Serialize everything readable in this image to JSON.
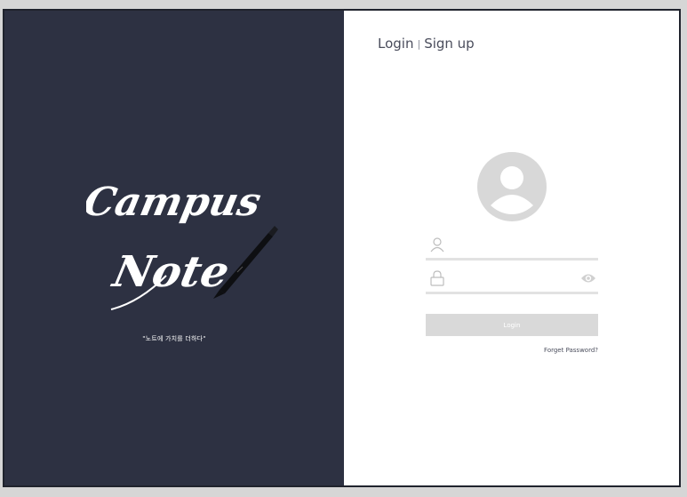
{
  "brand": {
    "logo_line1": "Campus",
    "logo_line2": "Note",
    "tagline": "\"노트에 가치를 더하다\""
  },
  "header": {
    "login_link": "Login",
    "separator": "|",
    "signup_link": "Sign up"
  },
  "form": {
    "username_placeholder": "",
    "password_placeholder": "",
    "login_button": "Login",
    "forgot_link": "Forget Password?"
  },
  "colors": {
    "panel_dark": "#2d3142",
    "page_bg": "#d6d6d6",
    "field_line": "#e2e2e2",
    "button_bg": "#d9d9d9",
    "icon_gray": "#d8d8d8"
  }
}
